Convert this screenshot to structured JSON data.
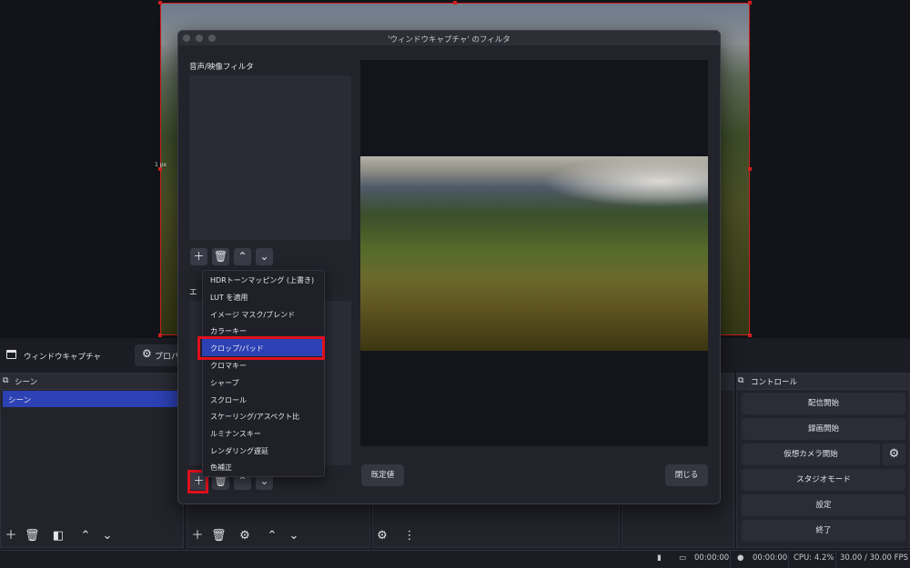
{
  "preview": {
    "px_label": "1 px"
  },
  "source_bar": {
    "source_name": "ウィンドウキャプチャ",
    "properties_label": "プロパ"
  },
  "scenes": {
    "title": "シーン",
    "items": [
      "シーン"
    ]
  },
  "controls": {
    "title": "コントロール",
    "buttons": {
      "start_streaming": "配信開始",
      "start_recording": "録画開始",
      "start_virtual_camera": "仮想カメラ開始",
      "studio_mode": "スタジオモード",
      "settings": "設定",
      "exit": "終了"
    }
  },
  "status": {
    "stream_time": "00:00:00",
    "record_time": "00:00:00",
    "cpu": "CPU: 4.2%",
    "fps": "30.00 / 30.00 FPS"
  },
  "dialog": {
    "title": "'ウィンドウキャプチャ' のフィルタ",
    "audio_video_label": "音声/映像フィルタ",
    "effect_label_partial": "エ",
    "default_button": "既定値",
    "close_button": "閉じる"
  },
  "filter_menu": {
    "items": [
      "HDRトーンマッピング (上書き)",
      "LUT を適用",
      "イメージ マスク/ブレンド",
      "カラーキー",
      "クロップ/パッド",
      "クロマキー",
      "シャープ",
      "スクロール",
      "スケーリング/アスペクト比",
      "ルミナンスキー",
      "レンダリング遅延",
      "色補正"
    ],
    "selected": "クロップ/パッド"
  },
  "colors": {
    "accent_blue": "#2c41b4",
    "highlight_red": "#e0101c",
    "source_border": "#d02020"
  },
  "icons": [
    "plus-icon",
    "trash-icon",
    "chevron-up-icon",
    "chevron-down-icon",
    "gear-icon",
    "window-icon",
    "scene-icon",
    "more-icon"
  ]
}
